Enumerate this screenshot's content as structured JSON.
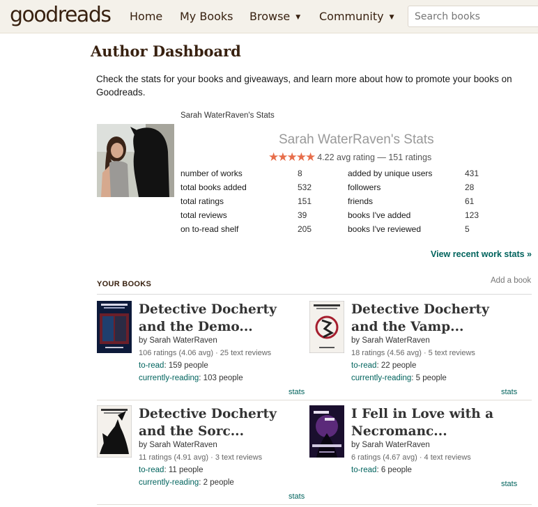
{
  "header": {
    "logo_light": "good",
    "logo_bold": "reads",
    "nav": [
      {
        "label": "Home"
      },
      {
        "label": "My Books"
      },
      {
        "label": "Browse",
        "dropdown": true
      },
      {
        "label": "Community",
        "dropdown": true
      }
    ],
    "search_placeholder": "Search books"
  },
  "page": {
    "title": "Author Dashboard",
    "intro": "Check the stats for your books and giveaways, and learn more about how to promote your books on Goodreads."
  },
  "stats": {
    "small_title": "Sarah WaterRaven's Stats",
    "big_title": "Sarah WaterRaven's Stats",
    "stars": "★★★★★",
    "rating_text": "4.22 avg rating — 151 ratings",
    "left": [
      {
        "label": "number of works",
        "value": "8"
      },
      {
        "label": "total books added",
        "value": "532"
      },
      {
        "label": "total ratings",
        "value": "151"
      },
      {
        "label": "total reviews",
        "value": "39"
      },
      {
        "label": "on to-read shelf",
        "value": "205"
      }
    ],
    "right": [
      {
        "label": "added by unique users",
        "value": "431"
      },
      {
        "label": "followers",
        "value": "28"
      },
      {
        "label": "friends",
        "value": "61"
      },
      {
        "label": "books I've added",
        "value": "123"
      },
      {
        "label": "books I've reviewed",
        "value": "5"
      }
    ],
    "recent_link": "View recent work stats »"
  },
  "books_section": {
    "heading": "YOUR BOOKS",
    "add_link": "Add a book"
  },
  "books": [
    {
      "title": "Detective Docherty and the Demo...",
      "by": "by Sarah WaterRaven",
      "meta": "106 ratings (4.06 avg) · 25 text reviews",
      "toread_label": "to-read",
      "toread_value": ": 159 people",
      "current_label": "currently-reading",
      "current_value": ": 103 people",
      "stats": "stats"
    },
    {
      "title": "Detective Docherty and the Vamp...",
      "by": "by Sarah WaterRaven",
      "meta": "18 ratings (4.56 avg) · 5 text reviews",
      "toread_label": "to-read",
      "toread_value": ": 22 people",
      "current_label": "currently-reading",
      "current_value": ": 5 people",
      "stats": "stats"
    },
    {
      "title": "Detective Docherty and the Sorc...",
      "by": "by Sarah WaterRaven",
      "meta": "11 ratings (4.91 avg) · 3 text reviews",
      "toread_label": "to-read",
      "toread_value": ": 11 people",
      "current_label": "currently-reading",
      "current_value": ": 2 people",
      "stats": "stats"
    },
    {
      "title": "I Fell in Love with a Necromanc...",
      "by": "by Sarah WaterRaven",
      "meta": "6 ratings (4.67 avg) · 4 text reviews",
      "toread_label": "to-read",
      "toread_value": ": 6 people",
      "stats": "stats"
    }
  ],
  "colors": {
    "header_bg": "#f4f1ea",
    "brand_brown": "#382110",
    "link_green": "#00635d",
    "star": "#e76e4b"
  }
}
